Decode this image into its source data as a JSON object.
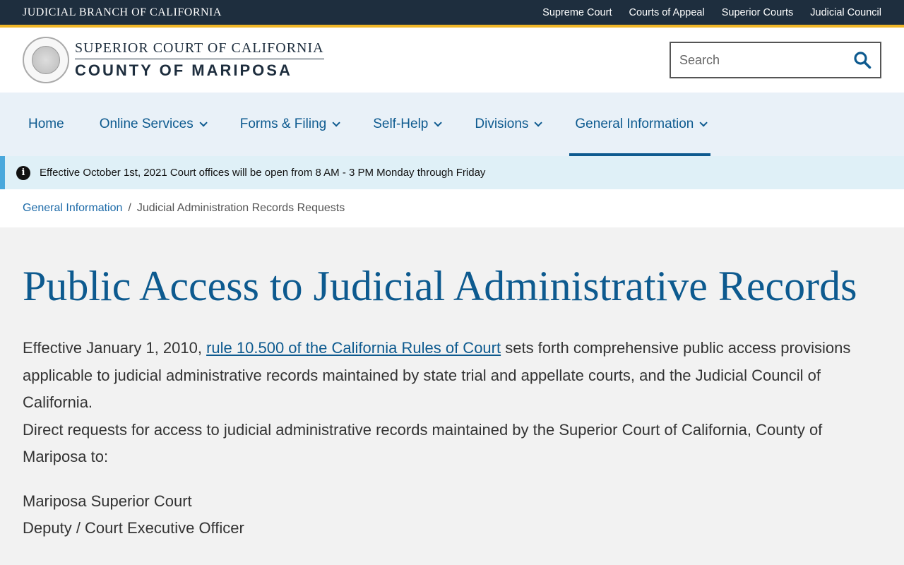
{
  "topbar": {
    "brand": "JUDICIAL BRANCH OF CALIFORNIA",
    "links": [
      "Supreme Court",
      "Courts of Appeal",
      "Superior Courts",
      "Judicial Council"
    ]
  },
  "header": {
    "logo_line1": "SUPERIOR COURT OF CALIFORNIA",
    "logo_line2": "COUNTY OF MARIPOSA",
    "search_placeholder": "Search"
  },
  "nav": {
    "items": [
      {
        "label": "Home",
        "dropdown": false
      },
      {
        "label": "Online Services",
        "dropdown": true
      },
      {
        "label": "Forms & Filing",
        "dropdown": true
      },
      {
        "label": "Self-Help",
        "dropdown": true
      },
      {
        "label": "Divisions",
        "dropdown": true
      },
      {
        "label": "General Information",
        "dropdown": true,
        "active": true
      }
    ]
  },
  "alert": {
    "text": "Effective October 1st, 2021 Court offices will be open from 8 AM - 3 PM Monday through Friday"
  },
  "breadcrumb": {
    "parent": "General Information",
    "separator": "/",
    "current": "Judicial Administration Records Requests"
  },
  "main": {
    "title": "Public Access to Judicial Administrative Records",
    "para1_before": "Effective January 1, 2010, ",
    "para1_link": "rule 10.500 of the California Rules of Court",
    "para1_after": " sets forth comprehensive public access provisions applicable to judicial administrative records maintained by state trial and appellate courts, and the Judicial Council of California.",
    "para2": "Direct requests for access to judicial administrative records maintained by the Superior Court of California, County of Mariposa to:",
    "address_line1": "Mariposa Superior Court",
    "address_line2": "Deputy / Court Executive Officer"
  },
  "colors": {
    "topbar_bg": "#1e2e3e",
    "accent_gold": "#f0b627",
    "link_blue": "#0d5a8f",
    "nav_bg": "#e9f1f8",
    "alert_bg": "#dff0f7"
  }
}
